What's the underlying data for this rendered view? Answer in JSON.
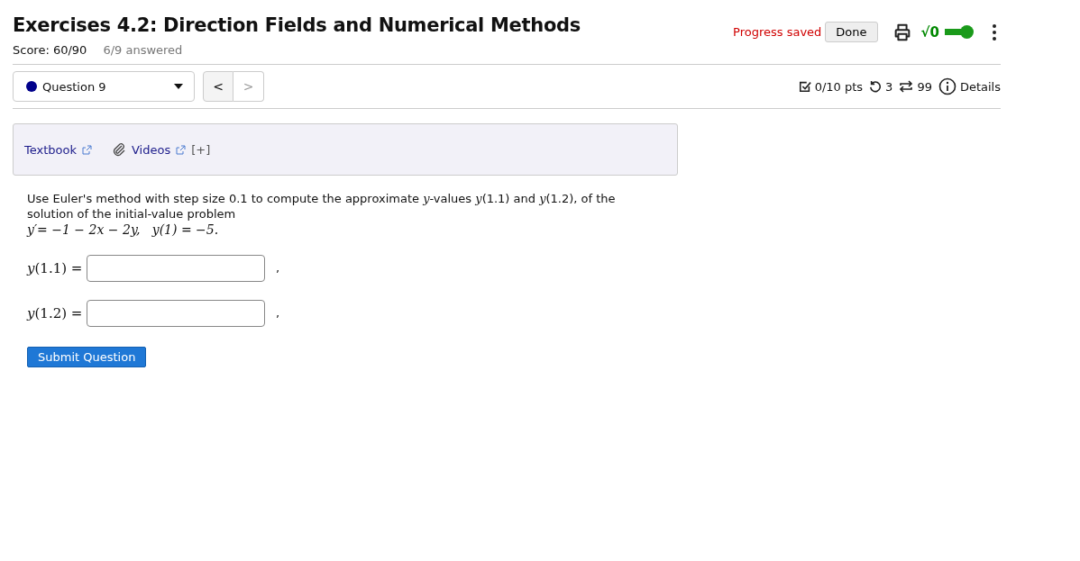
{
  "title": "Exercises 4.2: Direction Fields and Numerical Methods",
  "score": "Score: 60/90",
  "answered": "6/9 answered",
  "status": "Progress saved",
  "done_button": "Done",
  "math_toggle": {
    "label": "√0",
    "on": true
  },
  "question_select": {
    "label": "Question 9",
    "color": "#00008b"
  },
  "nav": {
    "prev": "<",
    "next": ">",
    "next_disabled": true
  },
  "stats": {
    "points": "0/10 pts",
    "retries": "3",
    "attempts": "99",
    "details": "Details"
  },
  "resources": [
    {
      "label": "Textbook",
      "attachment": false
    },
    {
      "label": "Videos",
      "attachment": true,
      "more": "[+]"
    }
  ],
  "question": {
    "text": "Use Euler's method with step size 0.1 to compute the approximate *y*-values *y*(1.1) and *y*(1.2), of the solution of the initial-value problem",
    "equation": "y′= −1 − 2x − 2y,   y(1) = −5."
  },
  "answers": [
    {
      "label": "*y*(1.1) =",
      "suffix": ","
    },
    {
      "label": "*y*(1.2) =",
      "suffix": ","
    }
  ],
  "submit": "Submit Question"
}
